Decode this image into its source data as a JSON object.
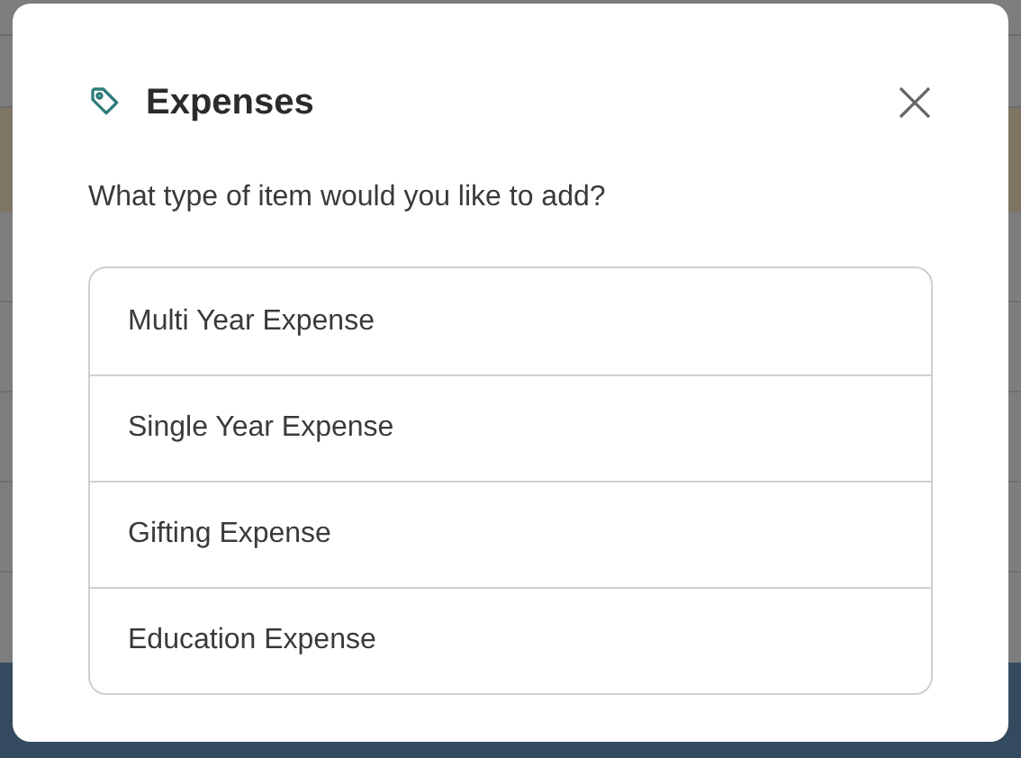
{
  "dialog": {
    "title": "Expenses",
    "prompt": "What type of item would you like to add?",
    "options": [
      {
        "label": "Multi Year Expense"
      },
      {
        "label": "Single Year Expense"
      },
      {
        "label": "Gifting Expense"
      },
      {
        "label": "Education Expense"
      }
    ]
  }
}
